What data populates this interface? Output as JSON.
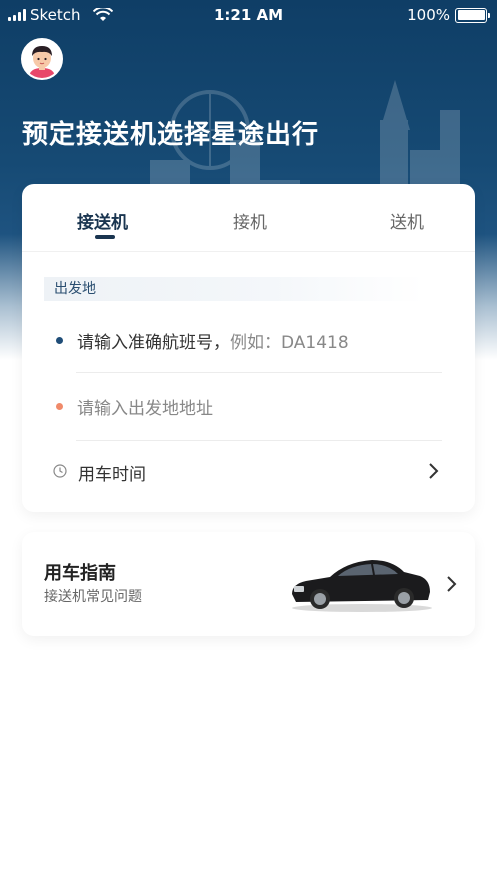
{
  "status_bar": {
    "carrier": "Sketch",
    "time": "1:21 AM",
    "battery": "100%"
  },
  "header": {
    "title": "预定接送机选择星途出行"
  },
  "booking": {
    "tabs": [
      {
        "label": "接送机",
        "active": true
      },
      {
        "label": "接机",
        "active": false
      },
      {
        "label": "送机",
        "active": false
      }
    ],
    "section_label": "出发地",
    "flight_field": {
      "label": "请输入准确航班号，",
      "hint": "例如：DA1418"
    },
    "departure_field": {
      "placeholder": "请输入出发地地址"
    },
    "time_row": {
      "label": "用车时间"
    }
  },
  "guide": {
    "title": "用车指南",
    "subtitle": "接送机常见问题"
  },
  "colors": {
    "header_bg": "#0f3e66",
    "accent": "#1a3550",
    "dot_blue": "#1f4d78",
    "dot_orange": "#f08a6a"
  },
  "icons": [
    "signal-icon",
    "wifi-icon",
    "battery-icon",
    "avatar",
    "clock-icon",
    "chevron-right-icon",
    "car-image"
  ]
}
